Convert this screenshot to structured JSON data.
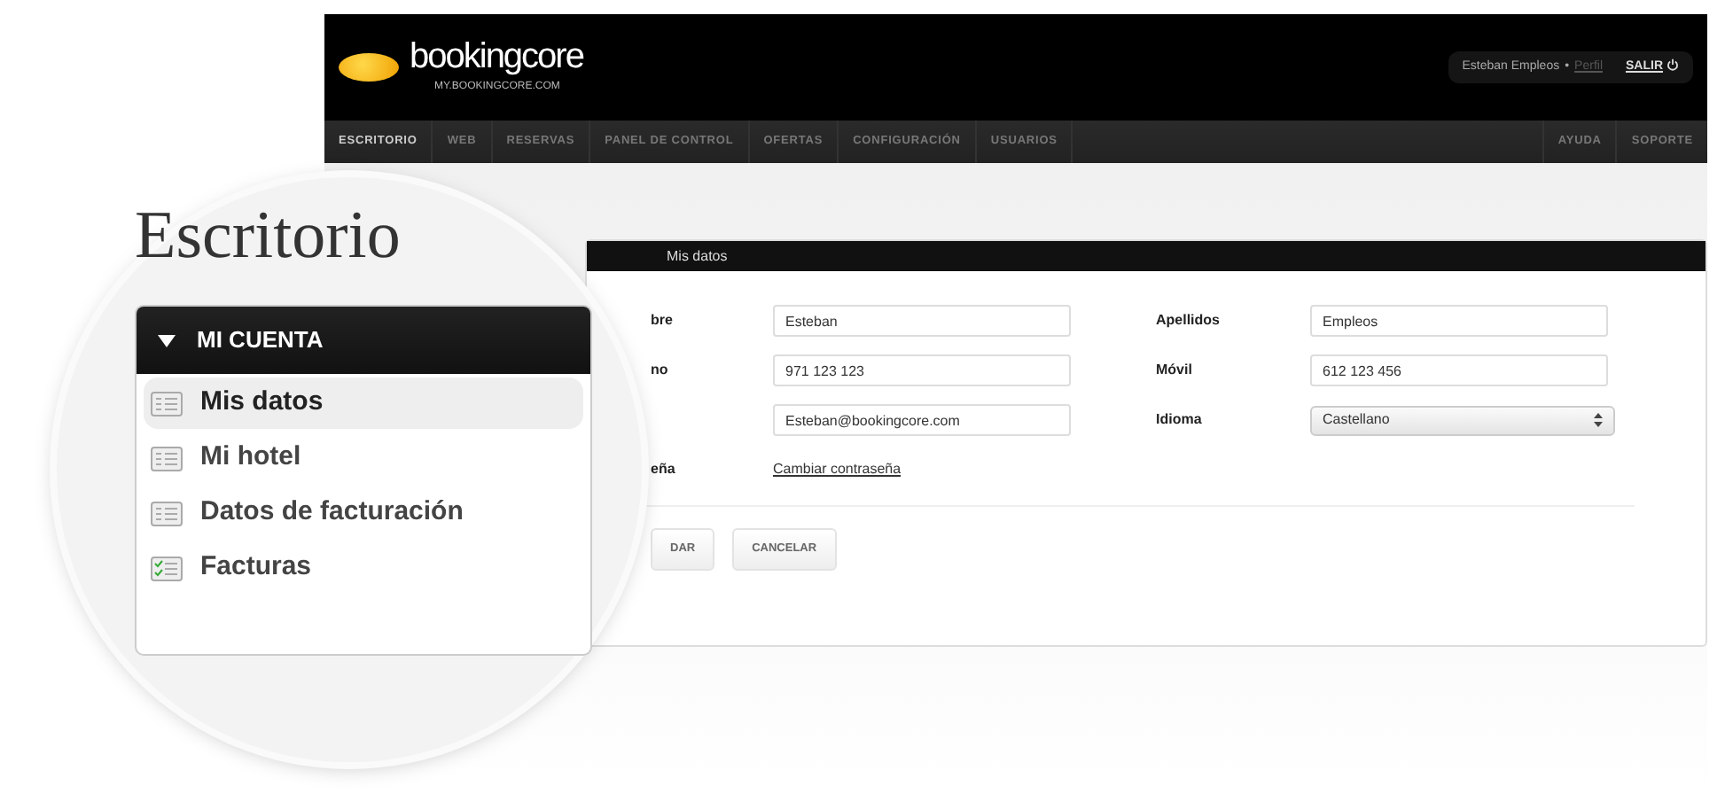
{
  "header": {
    "logo_name": "bookingcore",
    "logo_url": "MY.BOOKINGCORE.COM",
    "user": "Esteban Empleos",
    "separator": "•",
    "profile_link": "Perfil",
    "logout": "SALIR"
  },
  "nav": {
    "items": [
      {
        "label": "ESCRITORIO",
        "selected": true
      },
      {
        "label": "WEB",
        "selected": false
      },
      {
        "label": "RESERVAS",
        "selected": false
      },
      {
        "label": "PANEL DE CONTROL",
        "selected": false
      },
      {
        "label": "OFERTAS",
        "selected": false
      },
      {
        "label": "CONFIGURACIÓN",
        "selected": false
      },
      {
        "label": "USUARIOS",
        "selected": false
      }
    ],
    "right_items": [
      {
        "label": "AYUDA"
      },
      {
        "label": "SOPORTE"
      }
    ]
  },
  "panel": {
    "title": "Mis datos",
    "rows": [
      [
        {
          "label": "bre",
          "kind": "text",
          "value": "Esteban"
        },
        {
          "label": "Apellidos",
          "kind": "text",
          "value": "Empleos"
        }
      ],
      [
        {
          "label": "no",
          "kind": "text",
          "value": "971 123 123"
        },
        {
          "label": "Móvil",
          "kind": "text",
          "value": "612 123 456"
        }
      ],
      [
        {
          "kind": "text",
          "value": "Esteban@bookingcore.com"
        },
        {
          "label": "Idioma",
          "kind": "select",
          "value": "Castellano"
        }
      ],
      [
        {
          "label": "eña",
          "kind": "link",
          "value": "Cambiar contraseña"
        }
      ]
    ],
    "buttons": [
      "DAR",
      "CANCELAR"
    ]
  },
  "magnifier": {
    "title": "Escritorio",
    "menu": {
      "title": "MI CUENTA",
      "expanded": true,
      "items": [
        {
          "label": "Mis datos",
          "selected": true,
          "kind": "list"
        },
        {
          "label": "Mi hotel",
          "selected": false,
          "kind": "list"
        },
        {
          "label": "Datos de facturación",
          "selected": false,
          "kind": "list"
        },
        {
          "label": "Facturas",
          "selected": false,
          "kind": "checklist"
        }
      ]
    }
  }
}
